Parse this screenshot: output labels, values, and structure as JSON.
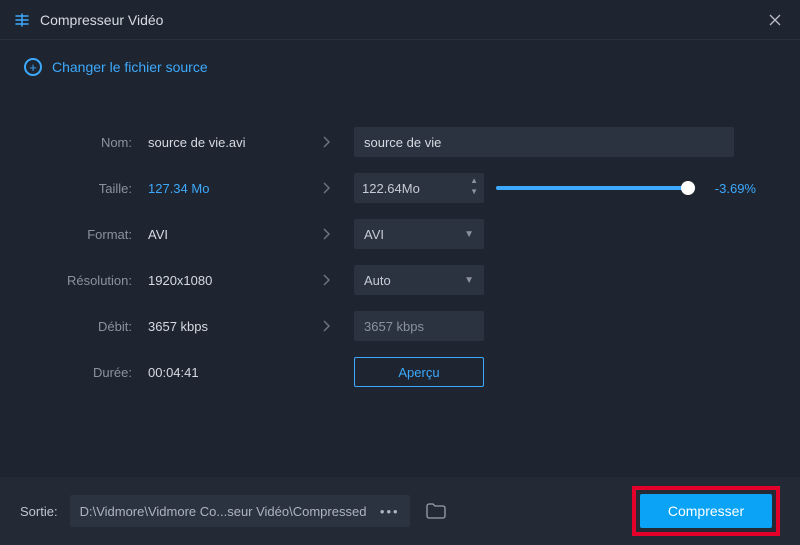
{
  "titlebar": {
    "title": "Compresseur Vidéo"
  },
  "changeSource": {
    "label": "Changer le fichier source"
  },
  "labels": {
    "name": "Nom:",
    "size": "Taille:",
    "format": "Format:",
    "resolution": "Résolution:",
    "bitrate": "Débit:",
    "duration": "Durée:"
  },
  "name": {
    "original": "source de vie.avi",
    "edit": "source de vie"
  },
  "size": {
    "original": "127.34 Mo",
    "target": "122.64Mo",
    "percent": "-3.69%"
  },
  "format": {
    "original": "AVI",
    "target": "AVI"
  },
  "resolution": {
    "original": "1920x1080",
    "target": "Auto"
  },
  "bitrate": {
    "original": "3657 kbps",
    "target": "3657 kbps"
  },
  "duration": {
    "value": "00:04:41"
  },
  "preview": {
    "label": "Aperçu"
  },
  "footer": {
    "label": "Sortie:",
    "path": "D:\\Vidmore\\Vidmore Co...seur Vidéo\\Compressed",
    "compress": "Compresser"
  }
}
